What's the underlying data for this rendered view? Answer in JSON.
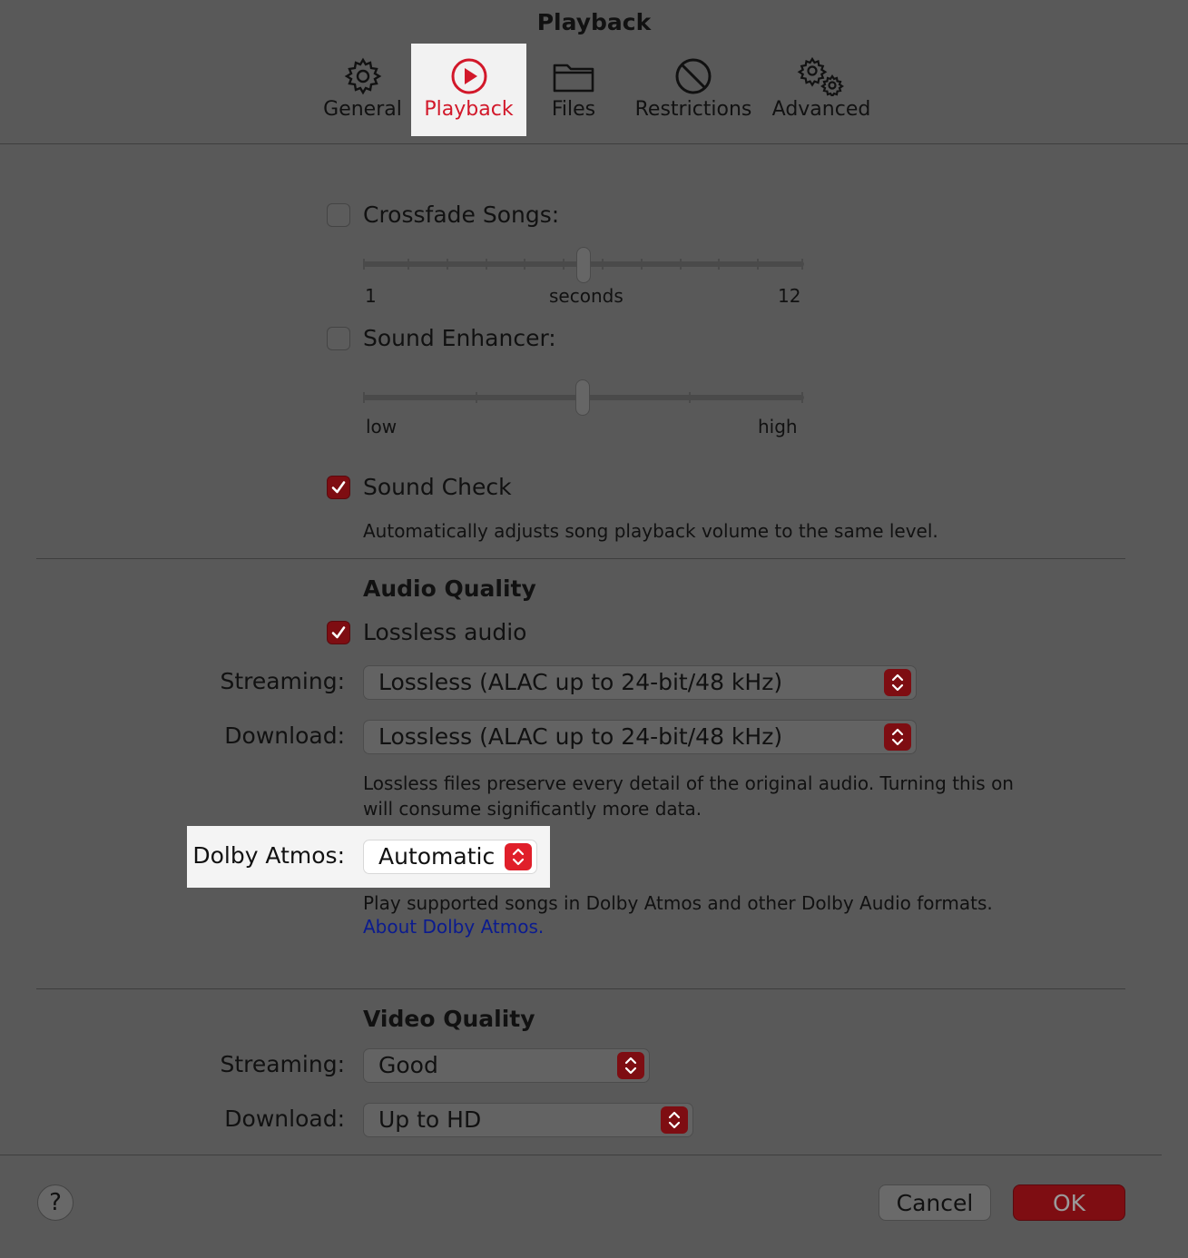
{
  "window": {
    "title": "Playback"
  },
  "tabs": [
    {
      "label": "General",
      "icon": "gear-icon"
    },
    {
      "label": "Playback",
      "icon": "play-circle-icon",
      "selected": true
    },
    {
      "label": "Files",
      "icon": "folder-icon"
    },
    {
      "label": "Restrictions",
      "icon": "prohibited-icon"
    },
    {
      "label": "Advanced",
      "icon": "gears-icon"
    }
  ],
  "crossfade": {
    "label": "Crossfade Songs:",
    "checked": false,
    "min_label": "1",
    "mid_label": "seconds",
    "max_label": "12",
    "value": 6,
    "min": 1,
    "max": 12
  },
  "enhancer": {
    "label": "Sound Enhancer:",
    "checked": false,
    "min_label": "low",
    "max_label": "high",
    "value": 0.5
  },
  "soundcheck": {
    "label": "Sound Check",
    "checked": true,
    "description": "Automatically adjusts song playback volume to the same level."
  },
  "audio": {
    "heading": "Audio Quality",
    "lossless_label": "Lossless audio",
    "lossless_checked": true,
    "streaming_label": "Streaming:",
    "streaming_value": "Lossless (ALAC up to 24-bit/48 kHz)",
    "download_label": "Download:",
    "download_value": "Lossless (ALAC up to 24-bit/48 kHz)",
    "note_line1": "Lossless files preserve every detail of the original audio. Turning this on",
    "note_line2": "will consume significantly more data.",
    "dolby_label": "Dolby Atmos:",
    "dolby_value": "Automatic",
    "dolby_note": "Play supported songs in Dolby Atmos and other Dolby Audio formats.",
    "dolby_link": "About Dolby Atmos."
  },
  "video": {
    "heading": "Video Quality",
    "streaming_label": "Streaming:",
    "streaming_value": "Good",
    "download_label": "Download:",
    "download_value": "Up to HD"
  },
  "footer": {
    "help": "?",
    "cancel": "Cancel",
    "ok": "OK"
  },
  "colors": {
    "accent": "#d2182a",
    "checkbox_on": "#7e0d12",
    "background": "#595959",
    "link": "#0b1b8f"
  }
}
